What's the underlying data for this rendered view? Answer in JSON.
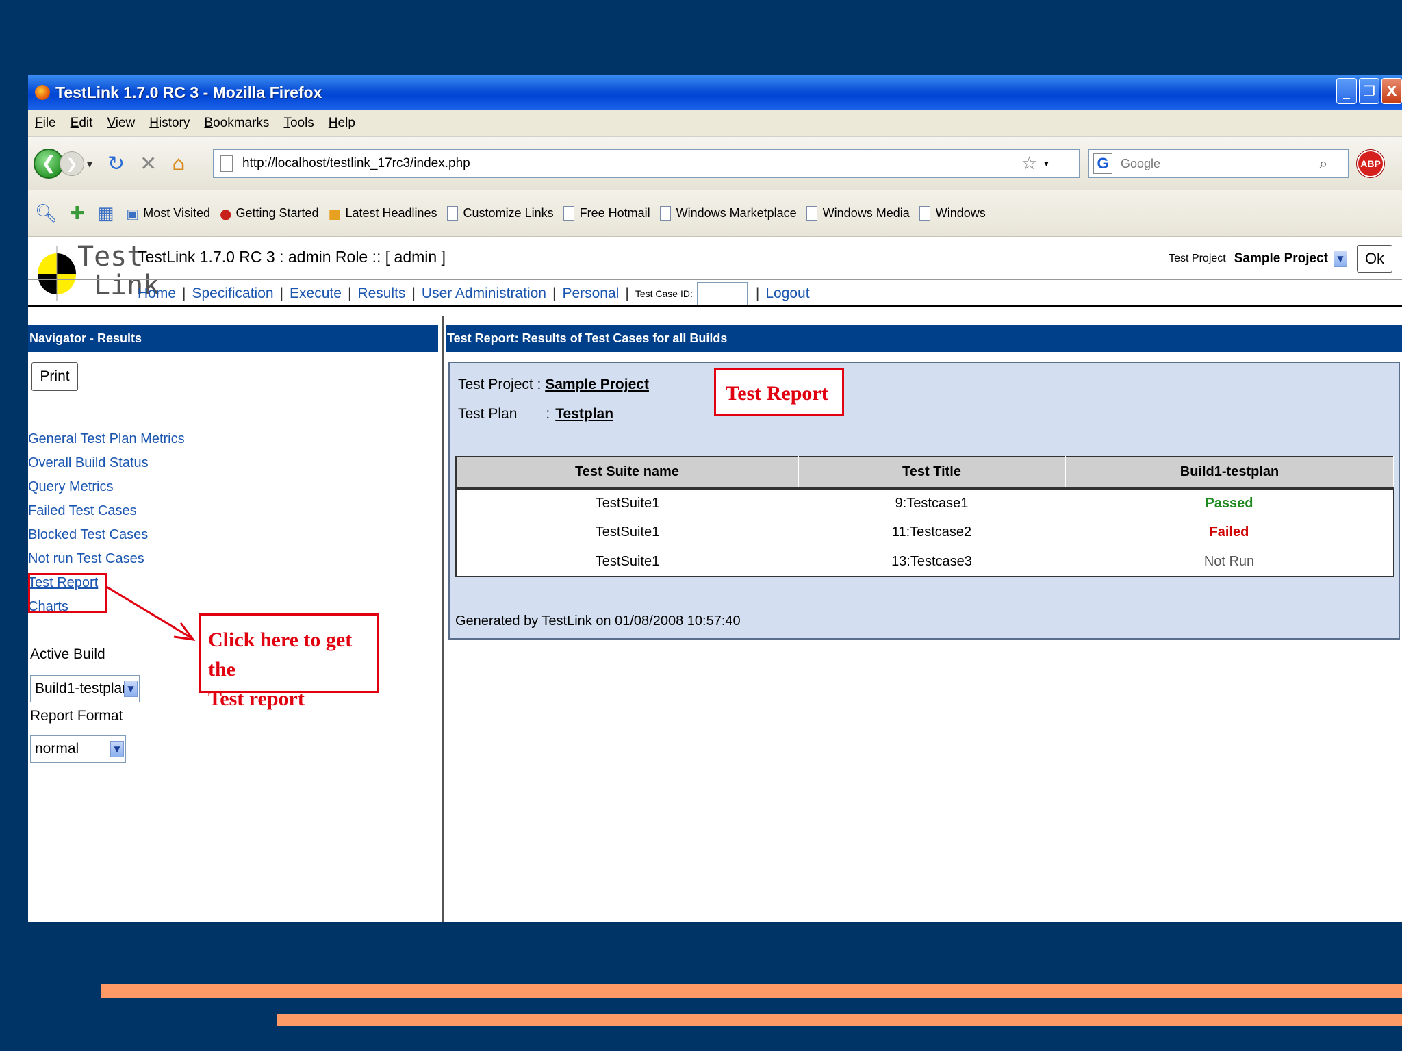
{
  "window": {
    "title": "TestLink 1.7.0 RC 3 - Mozilla Firefox",
    "controls": [
      "_",
      "❐",
      "X"
    ]
  },
  "menubar": [
    "File",
    "Edit",
    "View",
    "History",
    "Bookmarks",
    "Tools",
    "Help"
  ],
  "navbar": {
    "url": "http://localhost/testlink_17rc3/index.php",
    "search_placeholder": "Google",
    "addon_label": "ABP"
  },
  "bookmarks": [
    "Most Visited",
    "Getting Started",
    "Latest Headlines",
    "Customize Links",
    "Free Hotmail",
    "Windows Marketplace",
    "Windows Media",
    "Windows"
  ],
  "testlink": {
    "logo_line1": "Test",
    "logo_line2": "Link",
    "header_title": "TestLink 1.7.0 RC 3 : admin Role :: [ admin ]",
    "project_label": "Test Project",
    "project_value": "Sample Project",
    "ok_label": "Ok",
    "nav": [
      "Home",
      "Specification",
      "Execute",
      "Results",
      "User Administration",
      "Personal"
    ],
    "test_case_id_label": "Test Case ID:",
    "logout_label": "Logout"
  },
  "left": {
    "header": "Navigator - Results",
    "print_label": "Print",
    "links": [
      "General Test Plan Metrics",
      "Overall Build Status",
      "Query Metrics",
      "Failed Test Cases",
      "Blocked Test Cases",
      "Not run Test Cases",
      "Test Report",
      "Charts"
    ],
    "active_build_label": "Active Build",
    "active_build_value": "Build1-testplan",
    "report_format_label": "Report Format",
    "report_format_value": "normal"
  },
  "right": {
    "header": "Test Report: Results of Test Cases for all Builds",
    "project_label": "Test Project : ",
    "project_value": "Sample Project",
    "plan_label": "Test Plan",
    "plan_sep": ":",
    "plan_value": "Testplan",
    "table": {
      "columns": [
        "Test Suite name",
        "Test Title",
        "Build1-testplan"
      ],
      "rows": [
        [
          "TestSuite1",
          "9:Testcase1",
          "Passed"
        ],
        [
          "TestSuite1",
          "11:Testcase2",
          "Failed"
        ],
        [
          "TestSuite1",
          "13:Testcase3",
          "Not Run"
        ]
      ]
    },
    "generated": "Generated by TestLink on 01/08/2008 10:57:40"
  },
  "annotations": {
    "test_report": "Test Report",
    "click_line1": "Click here to get the",
    "click_line2": "Test report"
  },
  "colors": {
    "slide_background": "#003366",
    "panel_header": "#003f8a",
    "link": "#1a55b0",
    "annotation": "#e00010",
    "stripe": "#ff9966",
    "passed": "#1f8a1f",
    "failed": "#d00000"
  }
}
